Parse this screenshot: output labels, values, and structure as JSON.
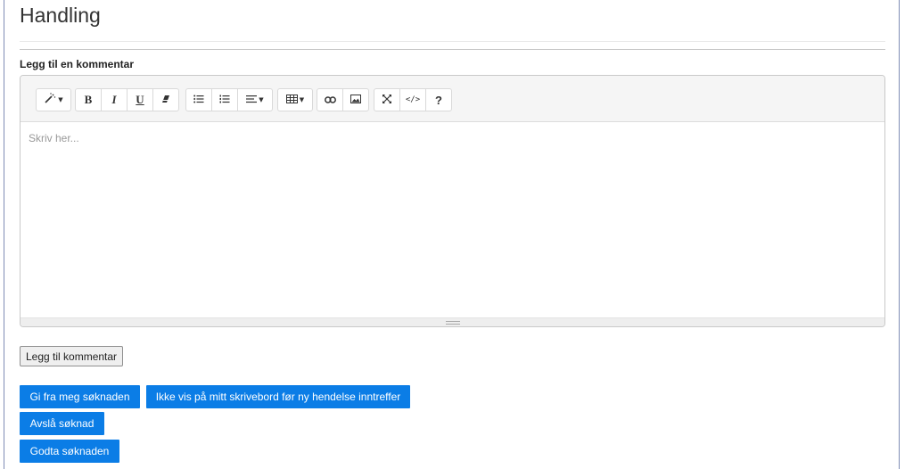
{
  "page": {
    "title": "Handling"
  },
  "comment": {
    "label": "Legg til en kommentar",
    "placeholder": "Skriv her..."
  },
  "toolbar": {
    "style_icon": "magic-wand-icon",
    "bold": "B",
    "italic": "I",
    "underline": "U",
    "eraser_icon": "eraser-icon",
    "ul_icon": "unordered-list-icon",
    "ol_icon": "ordered-list-icon",
    "align_icon": "align-icon",
    "table_icon": "table-icon",
    "link_icon": "link-icon",
    "picture_icon": "picture-icon",
    "fullscreen_icon": "fullscreen-icon",
    "codeview": "</>",
    "help": "?"
  },
  "actions": {
    "add_comment": "Legg til kommentar",
    "release": "Gi fra meg søknaden",
    "hide": "Ikke vis på mitt skrivebord før ny hendelse inntreffer",
    "reject": "Avslå søknad",
    "approve": "Godta søknaden"
  },
  "colors": {
    "primary": "#0b7de6",
    "frame": "#7f8db5"
  }
}
